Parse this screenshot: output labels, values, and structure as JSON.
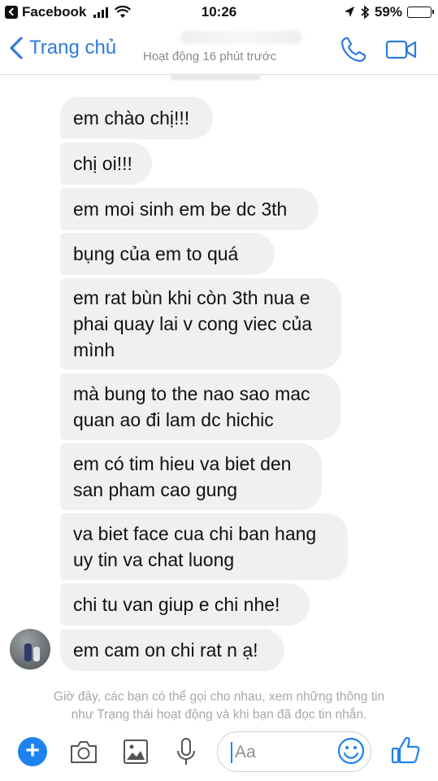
{
  "status_bar": {
    "app_back_label": "Facebook",
    "time": "10:26",
    "battery_percent": "59%",
    "battery_level": 0.59
  },
  "header": {
    "back_label": "Trang chủ",
    "activity": "Hoạt động 16 phút trước"
  },
  "messages": [
    {
      "text": "em chào chị!!!"
    },
    {
      "text": "chị oi!!!"
    },
    {
      "text": "em moi sinh em be dc 3th"
    },
    {
      "text": "bụng của em to quá"
    },
    {
      "text": "em rat bùn khi còn 3th nua e\nphai quay lai v cong viec của\nmình"
    },
    {
      "text": "mà bung to the nao sao mac\nquan ao đi lam dc hichic"
    },
    {
      "text": "em có tim hieu va biet den\nsan pham cao gung"
    },
    {
      "text": "va biet face cua chi ban hang\nuy tin va chat luong"
    },
    {
      "text": "chi tu van giup e chi nhe!"
    },
    {
      "text": "em cam on chi rat n ạ!"
    }
  ],
  "notice": {
    "line1": "Giờ đây, các bạn có thể gọi cho nhau, xem những thông tin",
    "line2": "như Trạng thái hoạt động và khi bạn đã đọc tin nhắn."
  },
  "composer": {
    "placeholder": "Aa"
  },
  "icons": [
    "back-chevron-icon",
    "phone-icon",
    "video-camera-icon",
    "plus-icon",
    "camera-icon",
    "gallery-icon",
    "microphone-icon",
    "emoji-icon",
    "thumbs-up-icon"
  ],
  "colors": {
    "accent": "#1d82ef",
    "bubble": "#f0f0f0",
    "back_link": "#2f7bdc"
  }
}
